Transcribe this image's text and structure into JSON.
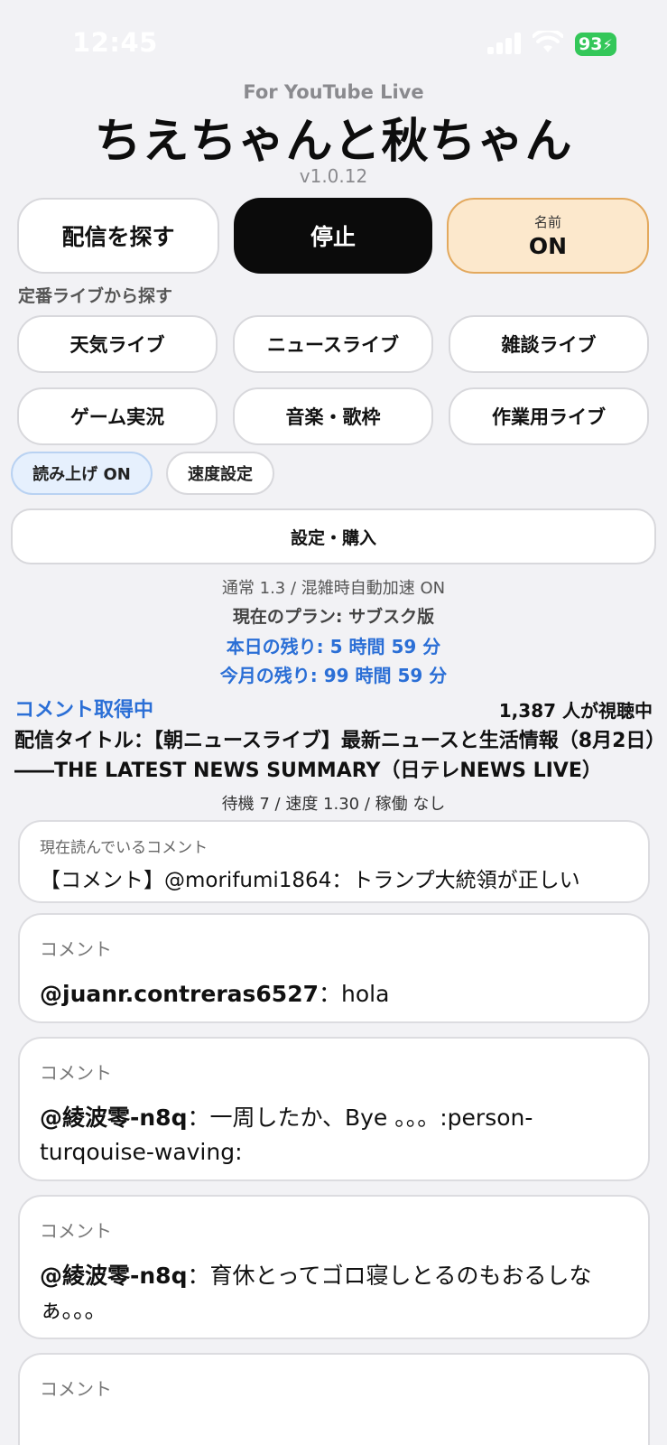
{
  "status_bar": {
    "time": "12:45",
    "battery": "93",
    "icons": [
      "cellular-signal-icon",
      "wifi-icon",
      "battery-charging-icon"
    ]
  },
  "header": {
    "subtitle": "For YouTube Live",
    "title": "ちえちゃんと秋ちゃん",
    "version": "v1.0.12"
  },
  "controls": {
    "find_stream": "配信を探す",
    "stop": "停止",
    "name_label": "名前",
    "name_state": "ON"
  },
  "categories": {
    "section_label": "定番ライブから探す",
    "items": [
      "天気ライブ",
      "ニュースライブ",
      "雑談ライブ",
      "ゲーム実況",
      "音楽・歌枠",
      "作業用ライブ"
    ]
  },
  "options": {
    "read_aloud": "読み上げ ON",
    "speed_settings": "速度設定",
    "settings_purchase": "設定・購入"
  },
  "info": {
    "speed_line": "通常 1.3 / 混雑時自動加速 ON",
    "plan": "現在のプラン: サブスク版",
    "today_remaining": "本日の残り: 5 時間 59 分",
    "month_remaining": "今月の残り: 99 時間 59 分"
  },
  "stream": {
    "fetch_status": "コメント取得中",
    "viewers": "1,387 人が視聴中",
    "title": "配信タイトル：【朝ニュースライブ】最新ニュースと生活情報（8月2日）――THE LATEST NEWS SUMMARY（日テレNEWS LIVE）",
    "queue": "待機 7 / 速度 1.30 / 稼働 なし"
  },
  "current_reading": {
    "label": "現在読んでいるコメント",
    "text": "【コメント】@morifumi1864：トランプ大統領が正しい"
  },
  "comments": [
    {
      "label": "コメント",
      "author": "@juanr.contreras6527",
      "text": "：hola"
    },
    {
      "label": "コメント",
      "author": "@綾波零-n8q",
      "text": "：一周したか、Bye 。。。:person-turqouise-waving:"
    },
    {
      "label": "コメント",
      "author": "@綾波零-n8q",
      "text": "：育休とってゴロ寝しとるのもおるしなぁ。。。"
    },
    {
      "label": "コメント",
      "author": "",
      "text": ""
    }
  ],
  "colors": {
    "accent_blue": "#2b6fd6",
    "stop_button": "#0b0b0b",
    "name_button_bg": "#fce8cc",
    "name_button_border": "#e3a95e",
    "background": "#f2f2f5"
  }
}
